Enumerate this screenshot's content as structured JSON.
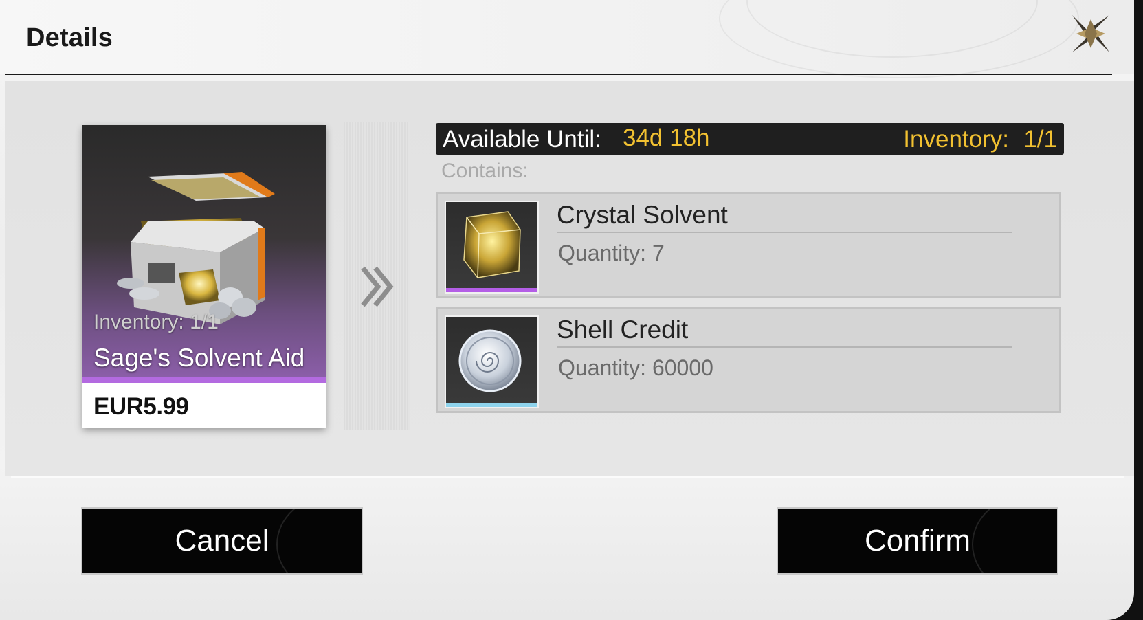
{
  "dialog": {
    "title": "Details"
  },
  "product": {
    "inventory": "Inventory: 1/1",
    "name": "Sage's Solvent Aid",
    "price": "EUR5.99"
  },
  "availability": {
    "label": "Available Until:",
    "value": "34d 18h",
    "inventory_label": "Inventory:",
    "inventory_value": "1/1"
  },
  "contains_label": "Contains:",
  "items": [
    {
      "name": "Crystal Solvent",
      "quantity": "Quantity: 7",
      "icon": "crystal-cube-icon",
      "rarity_color": "#b45ee6"
    },
    {
      "name": "Shell Credit",
      "quantity": "Quantity: 60000",
      "icon": "shell-coin-icon",
      "rarity_color": "#8ed3ec"
    }
  ],
  "buttons": {
    "cancel": "Cancel",
    "confirm": "Confirm"
  }
}
